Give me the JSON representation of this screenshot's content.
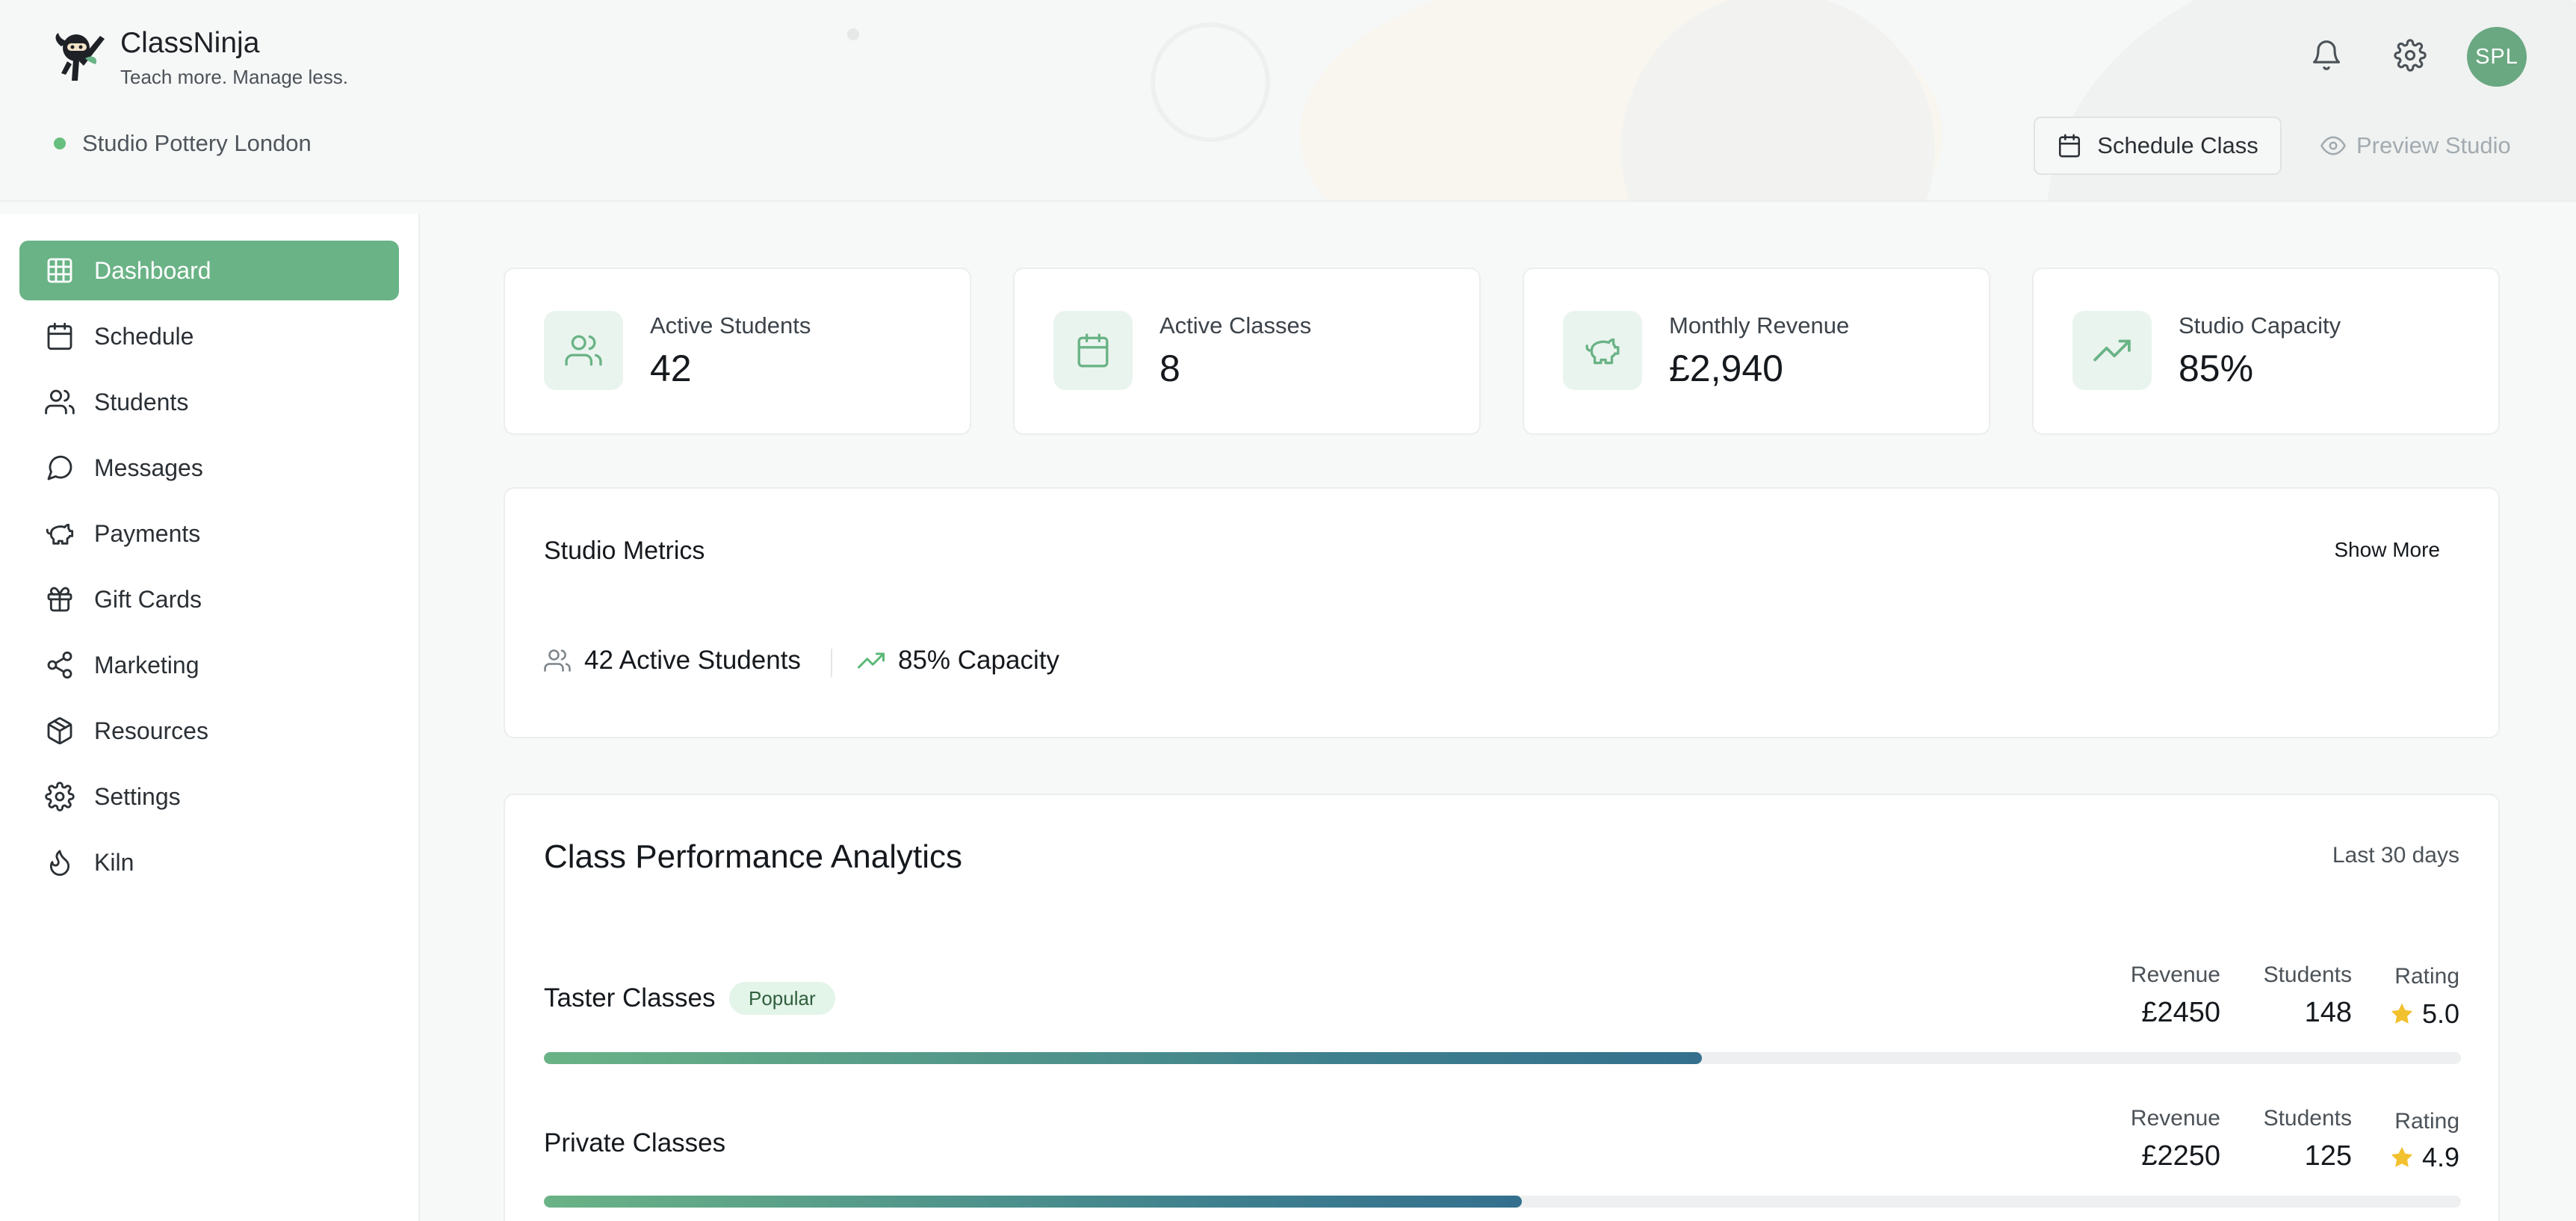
{
  "brand": {
    "name": "ClassNinja",
    "tagline": "Teach more. Manage less."
  },
  "studio": {
    "name": "Studio Pottery London",
    "status_color": "#66bf7e"
  },
  "header": {
    "avatar_initials": "SPL",
    "schedule_button": "Schedule Class",
    "preview_button": "Preview Studio",
    "icons": [
      "bell-icon",
      "gear-icon"
    ]
  },
  "theme": {
    "accent": "#6ab386",
    "accent_light": "#eaf4ee",
    "progress_start": "#6ab386",
    "progress_end": "#34708e",
    "star": "#f2c12e"
  },
  "sidebar": {
    "items": [
      {
        "label": "Dashboard",
        "icon": "grid-icon",
        "active": true
      },
      {
        "label": "Schedule",
        "icon": "calendar-icon",
        "active": false
      },
      {
        "label": "Students",
        "icon": "users-icon",
        "active": false
      },
      {
        "label": "Messages",
        "icon": "message-icon",
        "active": false
      },
      {
        "label": "Payments",
        "icon": "piggy-bank-icon",
        "active": false
      },
      {
        "label": "Gift Cards",
        "icon": "gift-icon",
        "active": false
      },
      {
        "label": "Marketing",
        "icon": "share-icon",
        "active": false
      },
      {
        "label": "Resources",
        "icon": "package-icon",
        "active": false
      },
      {
        "label": "Settings",
        "icon": "gear-icon",
        "active": false
      },
      {
        "label": "Kiln",
        "icon": "flame-icon",
        "active": false
      }
    ]
  },
  "stats": [
    {
      "label": "Active Students",
      "value": "42",
      "icon": "users-icon"
    },
    {
      "label": "Active Classes",
      "value": "8",
      "icon": "calendar-icon"
    },
    {
      "label": "Monthly Revenue",
      "value": "£2,940",
      "icon": "piggy-bank-icon"
    },
    {
      "label": "Studio Capacity",
      "value": "85%",
      "icon": "trending-up-icon"
    }
  ],
  "metrics": {
    "title": "Studio Metrics",
    "show_more": "Show More",
    "items": [
      {
        "text": "42 Active Students",
        "icon": "users-icon"
      },
      {
        "text": "85% Capacity",
        "icon": "trending-up-icon"
      }
    ]
  },
  "performance": {
    "title": "Class Performance Analytics",
    "range": "Last 30 days",
    "columns": {
      "revenue": "Revenue",
      "students": "Students",
      "rating": "Rating"
    },
    "rows": [
      {
        "name": "Taster Classes",
        "badge": "Popular",
        "revenue": "£2450",
        "students": "148",
        "rating": "5.0",
        "progress": 0.604
      },
      {
        "name": "Private Classes",
        "badge": "",
        "revenue": "£2250",
        "students": "125",
        "rating": "4.9",
        "progress": 0.51
      }
    ]
  }
}
